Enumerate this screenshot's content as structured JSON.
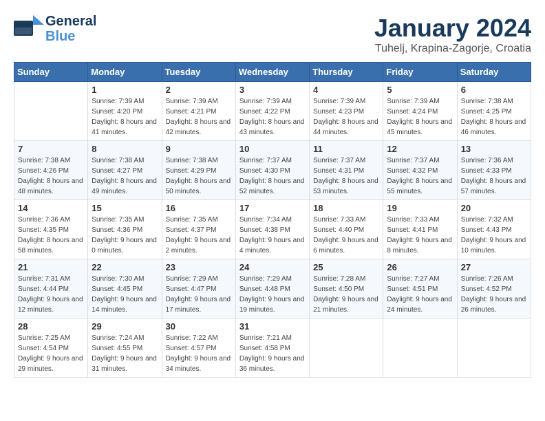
{
  "header": {
    "logo_line1": "General",
    "logo_line2": "Blue",
    "month": "January 2024",
    "location": "Tuhelj, Krapina-Zagorje, Croatia"
  },
  "weekdays": [
    "Sunday",
    "Monday",
    "Tuesday",
    "Wednesday",
    "Thursday",
    "Friday",
    "Saturday"
  ],
  "weeks": [
    [
      {
        "day": "",
        "sunrise": "",
        "sunset": "",
        "daylight": ""
      },
      {
        "day": "1",
        "sunrise": "Sunrise: 7:39 AM",
        "sunset": "Sunset: 4:20 PM",
        "daylight": "Daylight: 8 hours and 41 minutes."
      },
      {
        "day": "2",
        "sunrise": "Sunrise: 7:39 AM",
        "sunset": "Sunset: 4:21 PM",
        "daylight": "Daylight: 8 hours and 42 minutes."
      },
      {
        "day": "3",
        "sunrise": "Sunrise: 7:39 AM",
        "sunset": "Sunset: 4:22 PM",
        "daylight": "Daylight: 8 hours and 43 minutes."
      },
      {
        "day": "4",
        "sunrise": "Sunrise: 7:39 AM",
        "sunset": "Sunset: 4:23 PM",
        "daylight": "Daylight: 8 hours and 44 minutes."
      },
      {
        "day": "5",
        "sunrise": "Sunrise: 7:39 AM",
        "sunset": "Sunset: 4:24 PM",
        "daylight": "Daylight: 8 hours and 45 minutes."
      },
      {
        "day": "6",
        "sunrise": "Sunrise: 7:38 AM",
        "sunset": "Sunset: 4:25 PM",
        "daylight": "Daylight: 8 hours and 46 minutes."
      }
    ],
    [
      {
        "day": "7",
        "sunrise": "Sunrise: 7:38 AM",
        "sunset": "Sunset: 4:26 PM",
        "daylight": "Daylight: 8 hours and 48 minutes."
      },
      {
        "day": "8",
        "sunrise": "Sunrise: 7:38 AM",
        "sunset": "Sunset: 4:27 PM",
        "daylight": "Daylight: 8 hours and 49 minutes."
      },
      {
        "day": "9",
        "sunrise": "Sunrise: 7:38 AM",
        "sunset": "Sunset: 4:29 PM",
        "daylight": "Daylight: 8 hours and 50 minutes."
      },
      {
        "day": "10",
        "sunrise": "Sunrise: 7:37 AM",
        "sunset": "Sunset: 4:30 PM",
        "daylight": "Daylight: 8 hours and 52 minutes."
      },
      {
        "day": "11",
        "sunrise": "Sunrise: 7:37 AM",
        "sunset": "Sunset: 4:31 PM",
        "daylight": "Daylight: 8 hours and 53 minutes."
      },
      {
        "day": "12",
        "sunrise": "Sunrise: 7:37 AM",
        "sunset": "Sunset: 4:32 PM",
        "daylight": "Daylight: 8 hours and 55 minutes."
      },
      {
        "day": "13",
        "sunrise": "Sunrise: 7:36 AM",
        "sunset": "Sunset: 4:33 PM",
        "daylight": "Daylight: 8 hours and 57 minutes."
      }
    ],
    [
      {
        "day": "14",
        "sunrise": "Sunrise: 7:36 AM",
        "sunset": "Sunset: 4:35 PM",
        "daylight": "Daylight: 8 hours and 58 minutes."
      },
      {
        "day": "15",
        "sunrise": "Sunrise: 7:35 AM",
        "sunset": "Sunset: 4:36 PM",
        "daylight": "Daylight: 9 hours and 0 minutes."
      },
      {
        "day": "16",
        "sunrise": "Sunrise: 7:35 AM",
        "sunset": "Sunset: 4:37 PM",
        "daylight": "Daylight: 9 hours and 2 minutes."
      },
      {
        "day": "17",
        "sunrise": "Sunrise: 7:34 AM",
        "sunset": "Sunset: 4:38 PM",
        "daylight": "Daylight: 9 hours and 4 minutes."
      },
      {
        "day": "18",
        "sunrise": "Sunrise: 7:33 AM",
        "sunset": "Sunset: 4:40 PM",
        "daylight": "Daylight: 9 hours and 6 minutes."
      },
      {
        "day": "19",
        "sunrise": "Sunrise: 7:33 AM",
        "sunset": "Sunset: 4:41 PM",
        "daylight": "Daylight: 9 hours and 8 minutes."
      },
      {
        "day": "20",
        "sunrise": "Sunrise: 7:32 AM",
        "sunset": "Sunset: 4:43 PM",
        "daylight": "Daylight: 9 hours and 10 minutes."
      }
    ],
    [
      {
        "day": "21",
        "sunrise": "Sunrise: 7:31 AM",
        "sunset": "Sunset: 4:44 PM",
        "daylight": "Daylight: 9 hours and 12 minutes."
      },
      {
        "day": "22",
        "sunrise": "Sunrise: 7:30 AM",
        "sunset": "Sunset: 4:45 PM",
        "daylight": "Daylight: 9 hours and 14 minutes."
      },
      {
        "day": "23",
        "sunrise": "Sunrise: 7:29 AM",
        "sunset": "Sunset: 4:47 PM",
        "daylight": "Daylight: 9 hours and 17 minutes."
      },
      {
        "day": "24",
        "sunrise": "Sunrise: 7:29 AM",
        "sunset": "Sunset: 4:48 PM",
        "daylight": "Daylight: 9 hours and 19 minutes."
      },
      {
        "day": "25",
        "sunrise": "Sunrise: 7:28 AM",
        "sunset": "Sunset: 4:50 PM",
        "daylight": "Daylight: 9 hours and 21 minutes."
      },
      {
        "day": "26",
        "sunrise": "Sunrise: 7:27 AM",
        "sunset": "Sunset: 4:51 PM",
        "daylight": "Daylight: 9 hours and 24 minutes."
      },
      {
        "day": "27",
        "sunrise": "Sunrise: 7:26 AM",
        "sunset": "Sunset: 4:52 PM",
        "daylight": "Daylight: 9 hours and 26 minutes."
      }
    ],
    [
      {
        "day": "28",
        "sunrise": "Sunrise: 7:25 AM",
        "sunset": "Sunset: 4:54 PM",
        "daylight": "Daylight: 9 hours and 29 minutes."
      },
      {
        "day": "29",
        "sunrise": "Sunrise: 7:24 AM",
        "sunset": "Sunset: 4:55 PM",
        "daylight": "Daylight: 9 hours and 31 minutes."
      },
      {
        "day": "30",
        "sunrise": "Sunrise: 7:22 AM",
        "sunset": "Sunset: 4:57 PM",
        "daylight": "Daylight: 9 hours and 34 minutes."
      },
      {
        "day": "31",
        "sunrise": "Sunrise: 7:21 AM",
        "sunset": "Sunset: 4:58 PM",
        "daylight": "Daylight: 9 hours and 36 minutes."
      },
      {
        "day": "",
        "sunrise": "",
        "sunset": "",
        "daylight": ""
      },
      {
        "day": "",
        "sunrise": "",
        "sunset": "",
        "daylight": ""
      },
      {
        "day": "",
        "sunrise": "",
        "sunset": "",
        "daylight": ""
      }
    ]
  ]
}
